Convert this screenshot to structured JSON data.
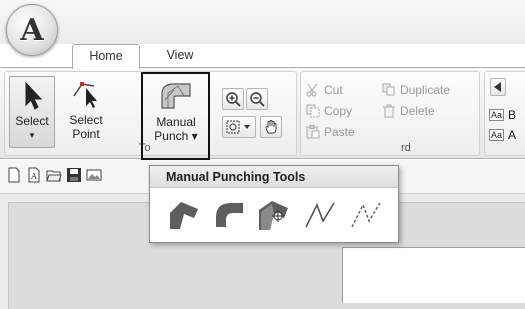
{
  "app_button": {
    "letter": "A"
  },
  "tabs": {
    "home": "Home",
    "view": "View"
  },
  "tools_group": {
    "label": "To",
    "select": {
      "line1": "Select",
      "line2": "▾"
    },
    "select_point": {
      "line1": "Select",
      "line2": "Point"
    },
    "manual_punch": {
      "line1": "Manual",
      "line2": "Punch ▾"
    }
  },
  "clipboard_group": {
    "label": "rd",
    "cut": "Cut",
    "copy": "Copy",
    "paste": "Paste",
    "duplicate": "Duplicate",
    "delete": "Delete"
  },
  "text_group": {
    "item1": "B",
    "item2": "A"
  },
  "popup": {
    "title": "Manual Punching Tools",
    "tools": [
      "fill-shape-tool-icon",
      "curve-shape-tool-icon",
      "shape-point-tool-icon",
      "line-tool-icon",
      "running-stitch-tool-icon"
    ]
  },
  "colors": {
    "accent": "#111111",
    "ribbon": "#e6e6e6",
    "icon_dark": "#555555"
  }
}
